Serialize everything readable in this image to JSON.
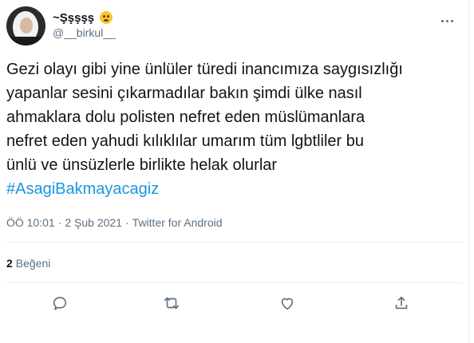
{
  "user": {
    "display_name": "~Şşşşş",
    "handle": "@__birkul__",
    "emoji": "hushed-face-icon"
  },
  "tweet": {
    "lines": [
      "Gezi olayı gibi yine ünlüler türedi inancımıza saygısızlığı",
      "yapanlar sesini çıkarmadılar bakın şimdi ülke nasıl",
      "ahmaklara dolu polisten nefret eden müslümanlara",
      "nefret eden yahudi kılıklılar umarım tüm lgbtliler bu",
      "ünlü ve ünsüzlerle birlikte helak olurlar"
    ],
    "hashtag": "#AsagiBakmayacagiz"
  },
  "meta": {
    "time": "ÖÖ 10:01",
    "separator": "·",
    "date": "2 Şub 2021",
    "source": "Twitter for Android"
  },
  "stats": {
    "likes_count": "2",
    "likes_label": "Beğeni"
  },
  "actions": [
    "reply-icon",
    "retweet-icon",
    "like-icon",
    "share-icon"
  ],
  "colors": {
    "link": "#1b95e0",
    "secondary_text": "#5b7083",
    "divider": "#e6ecf0"
  }
}
